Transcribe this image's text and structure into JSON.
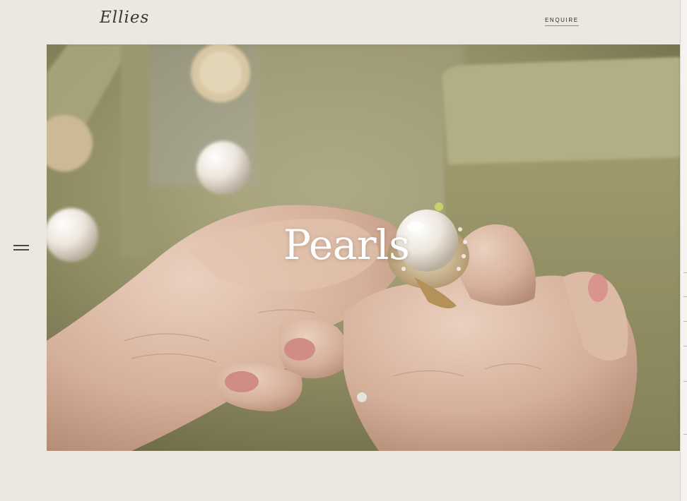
{
  "brand": {
    "logo_text": "Ellies"
  },
  "header": {
    "enquire_label": "ENQUIRE"
  },
  "nav": {
    "menu_icon": "hamburger-menu-icon"
  },
  "hero": {
    "title": "Pearls",
    "image_subject": "hands holding a pearl ring",
    "colors": {
      "velvet": "#8f8b5e",
      "skin": "#d9b7a2",
      "pearl": "#f1ede6"
    }
  }
}
